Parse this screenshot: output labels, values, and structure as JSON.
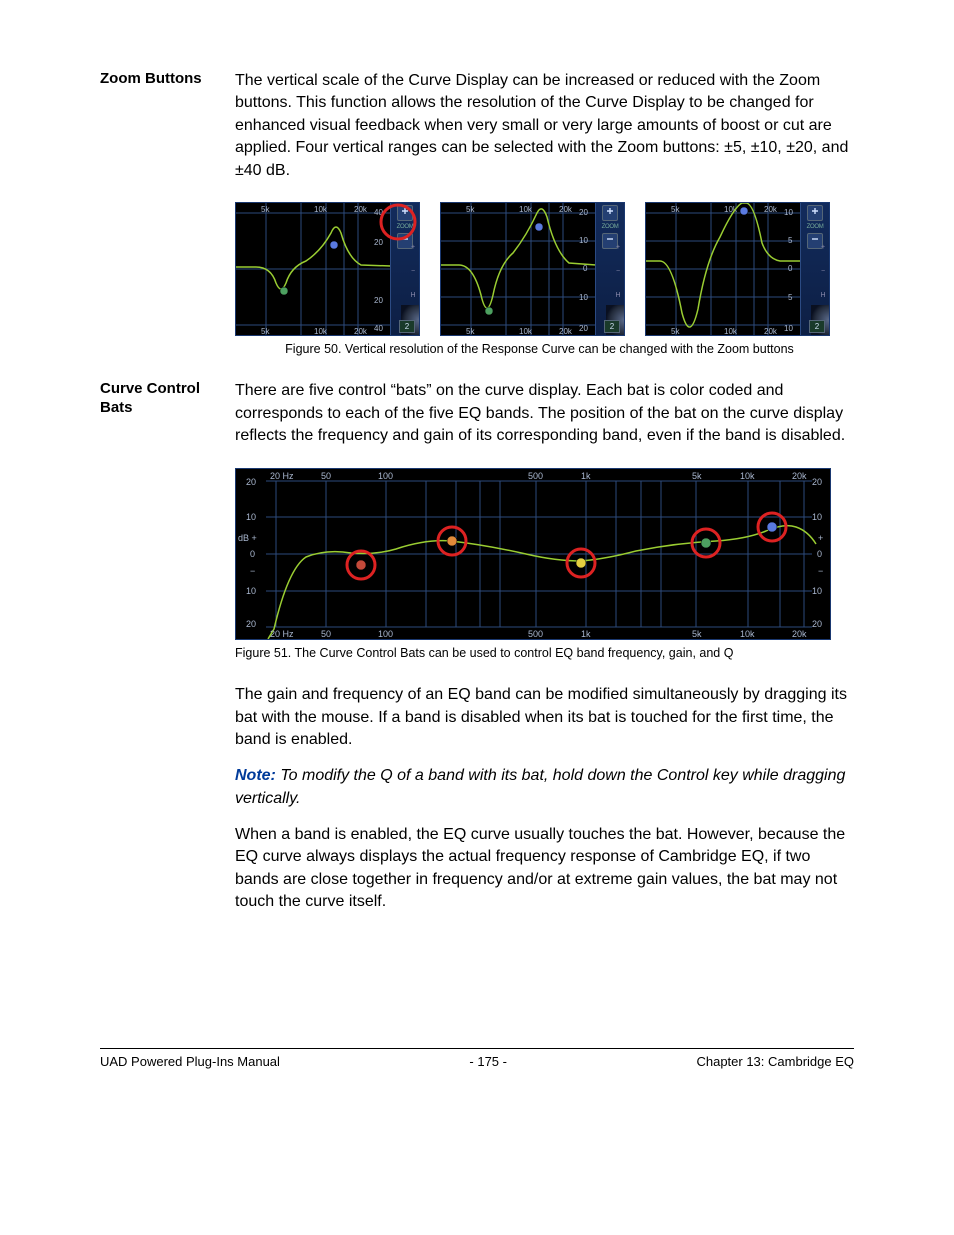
{
  "sections": {
    "zoom": {
      "heading": "Zoom Buttons",
      "para": "The vertical scale of the Curve Display can be increased or reduced with the Zoom buttons. This function allows the resolution of the Curve Display to be changed for enhanced visual feedback when very small or very large amounts of boost or cut are applied. Four vertical ranges can be selected with the Zoom buttons: ±5, ±10, ±20, and ±40 dB."
    },
    "fig50": {
      "caption": "Figure 50.  Vertical resolution of the Response Curve can be changed with the Zoom buttons",
      "panels": [
        {
          "top": "40",
          "mid": "20",
          "bot": "40"
        },
        {
          "top": "20",
          "mid": "10",
          "zero": "0",
          "neg": "10",
          "bot": "20"
        },
        {
          "top": "10",
          "mid": "5",
          "zero": "0",
          "neg": "5",
          "bot": "10"
        }
      ],
      "x_ticks": [
        "5k",
        "10k",
        "20k"
      ],
      "zoom_label": "ZOOM",
      "plus": "+",
      "minus": "−",
      "sq": "2"
    },
    "bats": {
      "heading": "Curve Control Bats",
      "para1": "There are five control “bats” on the curve display. Each bat is color coded and corresponds to each of the five EQ bands. The position of the bat on the curve display reflects the frequency and gain of its corresponding band, even if the band is disabled."
    },
    "fig51": {
      "caption": "Figure 51.  The Curve Control Bats can be used to control EQ band frequency, gain, and Q",
      "x_ticks": [
        "20 Hz",
        "50",
        "100",
        "500",
        "1k",
        "5k",
        "10k",
        "20k"
      ],
      "y_ticks": [
        "20",
        "10",
        "dB +",
        "0",
        "−",
        "10",
        "20"
      ]
    },
    "post": {
      "para2": "The gain and frequency of an EQ band can be modified simultaneously by dragging its bat with the mouse. If a band is disabled when its bat is touched for the first time, the band is enabled.",
      "note_label": "Note:",
      "note_body": " To modify the Q of a band with its bat, hold down the Control key while dragging vertically.",
      "para3": "When a band is enabled, the EQ curve usually touches the bat. However, because the EQ curve always displays the actual frequency response of Cambridge EQ, if two bands are close together in frequency and/or at extreme gain values, the bat may not touch the curve itself."
    }
  },
  "footer": {
    "left": "UAD Powered Plug-Ins Manual",
    "center": "- 175 -",
    "right": "Chapter 13: Cambridge EQ"
  },
  "scale_marks": {
    "plus": "+",
    "minus": "−",
    "h": "H"
  }
}
